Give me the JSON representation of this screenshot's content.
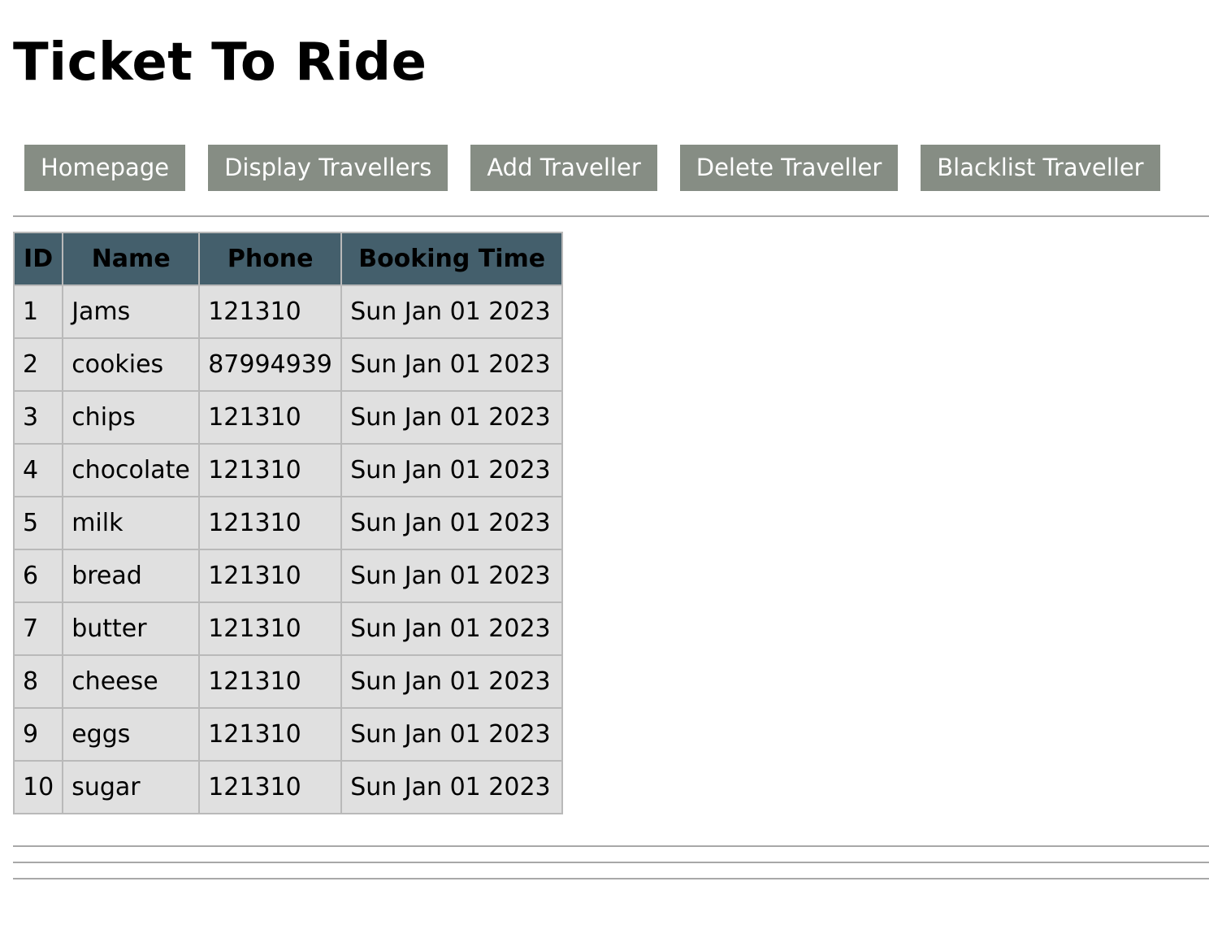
{
  "header": {
    "title": "Ticket To Ride"
  },
  "nav": {
    "items": [
      {
        "label": "Homepage"
      },
      {
        "label": "Display Travellers"
      },
      {
        "label": "Add Traveller"
      },
      {
        "label": "Delete Traveller"
      },
      {
        "label": "Blacklist Traveller"
      }
    ]
  },
  "table": {
    "columns": [
      "ID",
      "Name",
      "Phone",
      "Booking Time"
    ],
    "rows": [
      {
        "id": "1",
        "name": "Jams",
        "phone": "121310",
        "booking_time": "Sun Jan 01 2023"
      },
      {
        "id": "2",
        "name": "cookies",
        "phone": "87994939",
        "booking_time": "Sun Jan 01 2023"
      },
      {
        "id": "3",
        "name": "chips",
        "phone": "121310",
        "booking_time": "Sun Jan 01 2023"
      },
      {
        "id": "4",
        "name": "chocolate",
        "phone": "121310",
        "booking_time": "Sun Jan 01 2023"
      },
      {
        "id": "5",
        "name": "milk",
        "phone": "121310",
        "booking_time": "Sun Jan 01 2023"
      },
      {
        "id": "6",
        "name": "bread",
        "phone": "121310",
        "booking_time": "Sun Jan 01 2023"
      },
      {
        "id": "7",
        "name": "butter",
        "phone": "121310",
        "booking_time": "Sun Jan 01 2023"
      },
      {
        "id": "8",
        "name": "cheese",
        "phone": "121310",
        "booking_time": "Sun Jan 01 2023"
      },
      {
        "id": "9",
        "name": "eggs",
        "phone": "121310",
        "booking_time": "Sun Jan 01 2023"
      },
      {
        "id": "10",
        "name": "sugar",
        "phone": "121310",
        "booking_time": "Sun Jan 01 2023"
      }
    ]
  },
  "colors": {
    "nav_button_bg": "#868d84",
    "nav_button_text": "#ffffff",
    "table_header_bg": "#445f6c",
    "table_cell_bg": "#e0e0e0",
    "border": "#b9b9b9",
    "rule": "#a8a8a8"
  }
}
